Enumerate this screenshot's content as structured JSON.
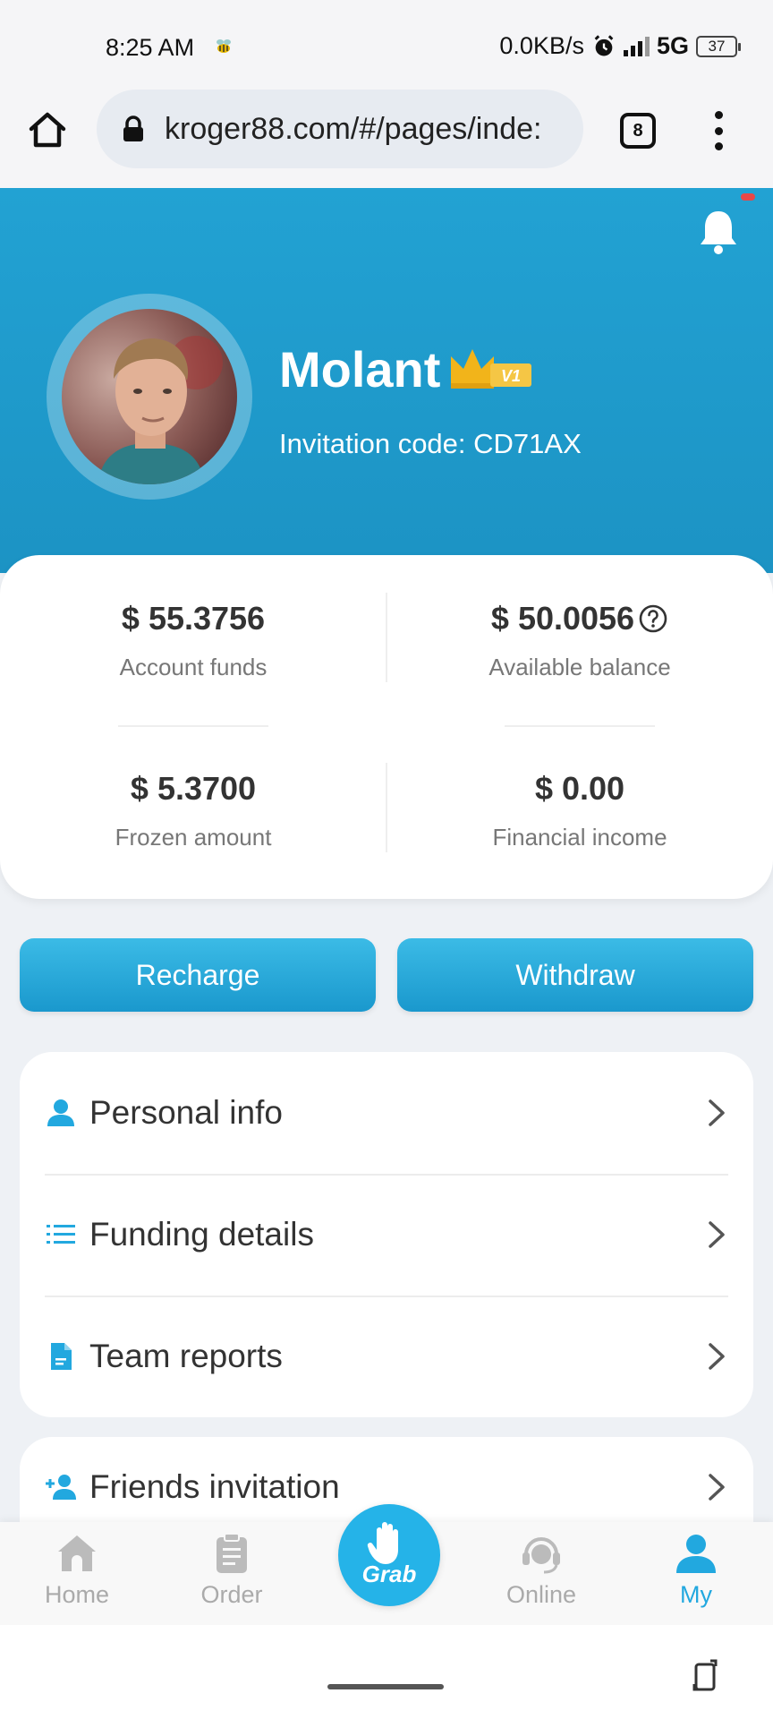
{
  "status_bar": {
    "time": "8:25 AM",
    "net_speed": "0.0KB/s",
    "network": "5G",
    "battery": "37"
  },
  "browser": {
    "url": "kroger88.com/#/pages/inde:",
    "tab_count": "8"
  },
  "profile": {
    "name": "Molant",
    "vip_level": "V1",
    "invitation_code": "Invitation code: CD71AX"
  },
  "stats": {
    "account_funds": {
      "value": "$ 55.3756",
      "label": "Account funds"
    },
    "available_balance": {
      "value": "$ 50.0056",
      "label": "Available balance"
    },
    "frozen_amount": {
      "value": "$ 5.3700",
      "label": "Frozen amount"
    },
    "financial_income": {
      "value": "$ 0.00",
      "label": "Financial income"
    }
  },
  "actions": {
    "recharge": "Recharge",
    "withdraw": "Withdraw"
  },
  "menu": {
    "items": [
      {
        "label": "Personal info",
        "icon": "person-icon"
      },
      {
        "label": "Funding details",
        "icon": "list-icon"
      },
      {
        "label": "Team reports",
        "icon": "document-icon"
      },
      {
        "label": "Friends invitation",
        "icon": "add-person-icon"
      }
    ]
  },
  "bottom_nav": {
    "home": "Home",
    "order": "Order",
    "grab": "Grab",
    "online": "Online",
    "my": "My",
    "active": "My"
  },
  "colors": {
    "accent": "#22a8df",
    "header": "#1c93c4",
    "text": "#333333",
    "muted": "#777777"
  }
}
